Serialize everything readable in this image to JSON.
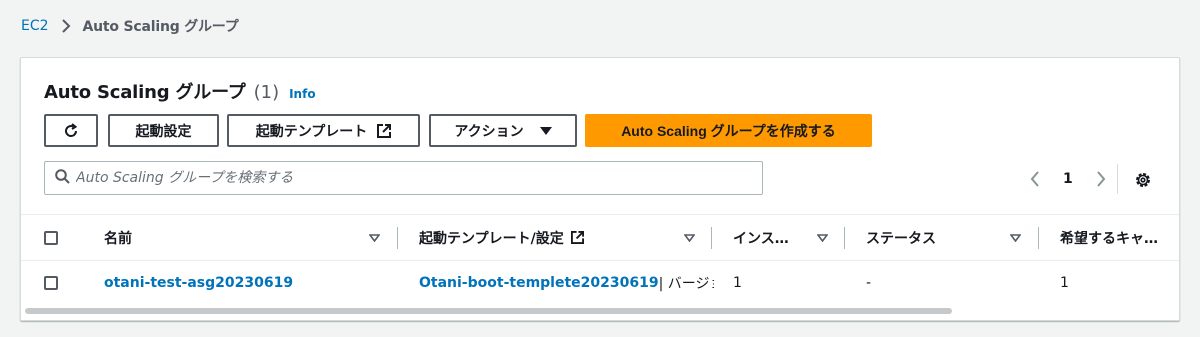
{
  "breadcrumb": {
    "root": "EC2",
    "current": "Auto Scaling グループ"
  },
  "header": {
    "title": "Auto Scaling グループ",
    "count": "(1)",
    "info": "Info"
  },
  "toolbar": {
    "launch_config_label": "起動設定",
    "launch_template_label": "起動テンプレート",
    "actions_label": "アクション",
    "create_label": "Auto Scaling グループを作成する"
  },
  "search": {
    "placeholder": "Auto Scaling グループを検索する",
    "value": ""
  },
  "pagination": {
    "current_page": "1"
  },
  "table": {
    "columns": [
      "名前",
      "起動テンプレート/設定",
      "インス…",
      "ステータス",
      "希望するキャ…"
    ],
    "rows": [
      {
        "name": "otani-test-asg20230619",
        "launch_template": "Otani-boot-templete20230619",
        "launch_suffix": " | バージョ",
        "instances": "1",
        "status": "-",
        "desired": "1"
      }
    ]
  },
  "colors": {
    "link": "#0073bb",
    "primary": "#ff9900",
    "border": "#545b64"
  },
  "icons": [
    "chevron-right-icon",
    "refresh-icon",
    "external-link-icon",
    "caret-down-icon",
    "search-icon",
    "chevron-left-icon",
    "settings-icon",
    "sort-icon"
  ]
}
